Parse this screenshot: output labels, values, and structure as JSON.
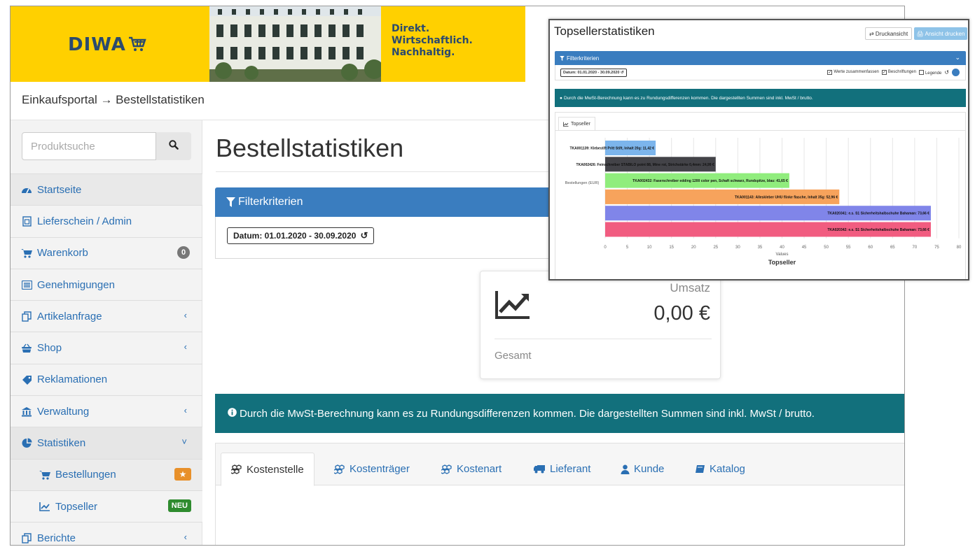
{
  "header": {
    "logo_text": "DIWA",
    "slogan": [
      "Direkt.",
      "Wirtschaftlich.",
      "Nachhaltig."
    ]
  },
  "breadcrumb": "Einkaufsportal → Bestellstatistiken",
  "search": {
    "placeholder": "Produktsuche"
  },
  "sidebar": {
    "items": [
      {
        "label": "Startseite",
        "icon": "dashboard-icon"
      },
      {
        "label": "Lieferschein / Admin",
        "icon": "document-icon"
      },
      {
        "label": "Warenkorb",
        "icon": "cart-icon",
        "badge": "0"
      },
      {
        "label": "Genehmigungen",
        "icon": "list-icon"
      },
      {
        "label": "Artikelanfrage",
        "icon": "copy-icon",
        "arrow": "‹"
      },
      {
        "label": "Shop",
        "icon": "basket-icon",
        "arrow": "‹"
      },
      {
        "label": "Reklamationen",
        "icon": "tag-icon"
      },
      {
        "label": "Verwaltung",
        "icon": "bank-icon",
        "arrow": "‹"
      },
      {
        "label": "Statistiken",
        "icon": "pie-chart-icon",
        "arrow": "˅"
      },
      {
        "label": "Bestellungen",
        "icon": "cart-icon",
        "badge": "★"
      },
      {
        "label": "Topseller",
        "icon": "line-chart-icon",
        "badge": "NEU"
      },
      {
        "label": "Berichte",
        "icon": "copy-icon",
        "arrow": "‹"
      }
    ]
  },
  "main": {
    "title": "Bestellstatistiken",
    "filter_label": "Filterkriterien",
    "date_label": "Datum: 01.01.2020 - 30.09.2020",
    "umsatz": {
      "label": "Umsatz",
      "value": "0,00 €",
      "footer": "Gesamt"
    },
    "info": "Durch die MwSt-Berechnung kann es zu Rundungsdifferenzen kommen. Die dargestellten Summen sind inkl. MwSt / brutto.",
    "tabs": [
      "Kostenstelle",
      "Kostenträger",
      "Kostenart",
      "Lieferant",
      "Kunde",
      "Katalog"
    ]
  },
  "overlay": {
    "title": "Topsellerstatistiken",
    "btn_print_view": "⇄ Druckansicht",
    "btn_print": "🖨 Ansicht drucken",
    "filter_label": "Filterkriterien",
    "date_label": "Datum: 01.01.2020 - 30.09.2020",
    "checks": [
      {
        "label": "Werte zusammenfassen",
        "checked": true
      },
      {
        "label": "Beschriftungen",
        "checked": true
      },
      {
        "label": "Legende",
        "checked": false
      }
    ],
    "info": "Durch die MwSt-Berechnung kann es zu Rundungsdifferenzen kommen. Die dargestellten Summen sind inkl. MwSt / brutto.",
    "tab_label": "Topseller"
  },
  "chart_data": {
    "type": "bar",
    "orientation": "horizontal",
    "title": "Topseller",
    "xlabel": "Values",
    "ylabel": "Bestellungen (EUR)",
    "xlim": [
      0,
      80
    ],
    "xticks": [
      0,
      5,
      10,
      15,
      20,
      25,
      30,
      35,
      40,
      45,
      50,
      55,
      60,
      65,
      70,
      75,
      80
    ],
    "grid": true,
    "bars": [
      {
        "label": "TKA001139: Klebestift Pritt Stift, Inhalt 20g: 11,42 €",
        "value": 11.42,
        "color": "#7cb5ec"
      },
      {
        "label": "TKA002426: Feinschreiber STABILO point 88, Mine rot, Strichstärke 0,4mm: 24,99 €",
        "value": 24.99,
        "color": "#434348"
      },
      {
        "label": "TKA002432: Faserschreiber edding 1200 color pen, Schaft schwarz, Rundspitze, blau: 41,65 €",
        "value": 41.65,
        "color": "#90ed7d"
      },
      {
        "label": "TKA001143: Alleskleber UHU flinke flasche, Inhalt 35g: 52,96 €",
        "value": 52.96,
        "color": "#f7a35c"
      },
      {
        "label": "TKA020341: e.s. S1 Sicherheitshalbschuhe Bahaman: 73,66 €",
        "value": 73.66,
        "color": "#8085e9"
      },
      {
        "label": "TKA020342: e.s. S1 Sicherheitshalbschuhe Bahaman: 73,66 €",
        "value": 73.66,
        "color": "#f15c80"
      }
    ]
  }
}
